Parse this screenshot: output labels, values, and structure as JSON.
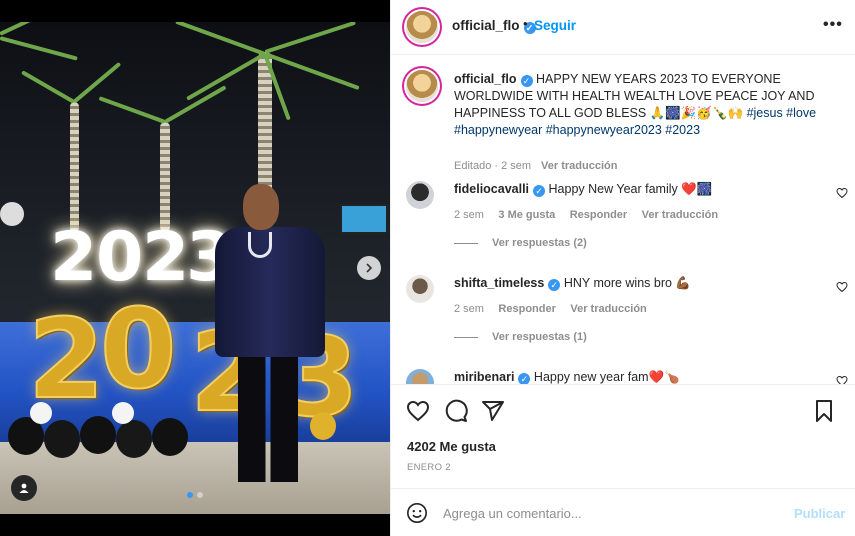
{
  "post": {
    "author": "official_flo",
    "follow_dot": "•",
    "follow_label": "Seguir",
    "more_label": "•••"
  },
  "caption": {
    "username": "official_flo",
    "text": "HAPPY NEW YEARS 2023 TO EVERYONE WORLDWIDE WITH HEALTH WEALTH LOVE PEACE JOY AND HAPPINESS TO ALL GOD BLESS 🙏🎆🎉🥳🍾🙌",
    "hashtags": "#jesus #love #happynewyear #happynewyear2023 #2023",
    "edited": "Editado · 2 sem",
    "translate": "Ver traducción"
  },
  "comments": [
    {
      "username": "fideliocavalli",
      "text": "Happy New Year family ❤️🎆",
      "time": "2 sem",
      "likes": "3 Me gusta",
      "reply": "Responder",
      "translate": "Ver traducción",
      "replies": "Ver respuestas (2)"
    },
    {
      "username": "shifta_timeless",
      "text": "HNY more wins bro 💪🏾",
      "time": "2 sem",
      "reply": "Responder",
      "translate": "Ver traducción",
      "replies": "Ver respuestas (1)"
    },
    {
      "username": "miribenari",
      "text": "Happy new year fam❤️🍗"
    }
  ],
  "stats": {
    "likes": "4202 Me gusta",
    "date": "ENERO 2"
  },
  "composer": {
    "placeholder": "Agrega un comentario...",
    "publish": "Publicar"
  },
  "photo": {
    "sign_digits": [
      "2",
      "0",
      "2",
      "3"
    ],
    "balloon_digits": [
      "2",
      "0",
      "2",
      "3"
    ]
  },
  "icons": {
    "like": "heart-icon",
    "comment": "comment-icon",
    "share": "share-icon",
    "save": "bookmark-icon",
    "emoji": "emoji-icon",
    "tag": "user-tag-icon",
    "next": "chevron-right-icon"
  },
  "colors": {
    "accent": "#0095f6",
    "verified": "#3897f0",
    "hashtag": "#00376b",
    "muted": "#8e8e8e",
    "publish_disabled": "#b2dffc"
  }
}
